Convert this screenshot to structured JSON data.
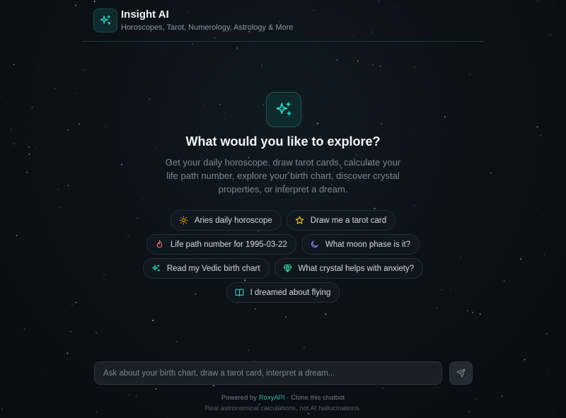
{
  "header": {
    "title": "Insight AI",
    "subtitle": "Horoscopes, Tarot, Numerology, Astrology & More",
    "logo_icon": "sparkles-icon"
  },
  "hero": {
    "icon": "sparkles-icon",
    "title": "What would you like to explore?",
    "description": "Get your daily horoscope, draw tarot cards, calculate your life path number, explore your birth chart, discover crystal properties, or interpret a dream."
  },
  "suggestions": [
    {
      "label": "Aries daily horoscope",
      "icon": "sun-icon",
      "color": "#f59e0b"
    },
    {
      "label": "Draw me a tarot card",
      "icon": "star-icon",
      "color": "#facc15"
    },
    {
      "label": "Life path number for 1995-03-22",
      "icon": "flame-icon",
      "color": "#f87171"
    },
    {
      "label": "What moon phase is it?",
      "icon": "moon-icon",
      "color": "#818cf8"
    },
    {
      "label": "Read my Vedic birth chart",
      "icon": "sparkles-icon",
      "color": "#2dd4bf"
    },
    {
      "label": "What crystal helps with anxiety?",
      "icon": "gem-icon",
      "color": "#34d399"
    },
    {
      "label": "I dreamed about flying",
      "icon": "book-icon",
      "color": "#2dd4bf"
    }
  ],
  "input": {
    "placeholder": "Ask about your birth chart, draw a tarot card, interpret a dream...",
    "value": "",
    "send_icon": "send-icon"
  },
  "footer": {
    "powered_prefix": "Powered by ",
    "powered_link": "RoxyAPI",
    "powered_sep": " · ",
    "clone_text": "Clone this chatbot",
    "tagline": "Real astronomical calculations, not AI hallucinations."
  },
  "colors": {
    "accent": "#2dd4bf",
    "background": "#0c1117"
  }
}
